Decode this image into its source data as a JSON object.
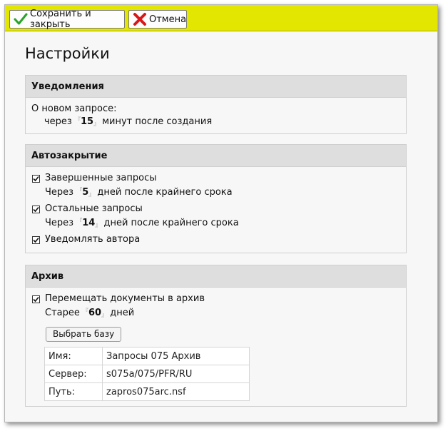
{
  "toolbar": {
    "save_label": "Сохранить и закрыть",
    "save_icon": "green-checkmark-icon",
    "cancel_label": "Отмена",
    "cancel_icon": "red-x-icon",
    "background": "#e3e600"
  },
  "page_title": "Настройки",
  "notifications": {
    "header": "Уведомления",
    "label": "О новом запросе:",
    "prefix": "через",
    "value": "15",
    "suffix": "минут после создания"
  },
  "autoclose": {
    "header": "Автозакрытие",
    "completed": {
      "label": "Завершенные запросы",
      "checked": true,
      "prefix": "Через",
      "value": "5",
      "suffix": "дней после крайнего срока"
    },
    "other": {
      "label": "Остальные запросы",
      "checked": true,
      "prefix": "Через",
      "value": "14",
      "suffix": "дней после крайнего срока"
    },
    "notify_author": {
      "label": "Уведомлять автора",
      "checked": true
    }
  },
  "archive": {
    "header": "Архив",
    "move_docs": {
      "label": "Перемещать документы в архив",
      "checked": true
    },
    "prefix": "Старее",
    "value": "60",
    "suffix": "дней",
    "select_db_button": "Выбрать базу",
    "table": [
      {
        "key": "Имя:",
        "value": "Запросы 075 Архив"
      },
      {
        "key": "Сервер:",
        "value": "s075a/075/PFR/RU"
      },
      {
        "key": "Путь:",
        "value": "zapros075arc.nsf"
      }
    ]
  }
}
